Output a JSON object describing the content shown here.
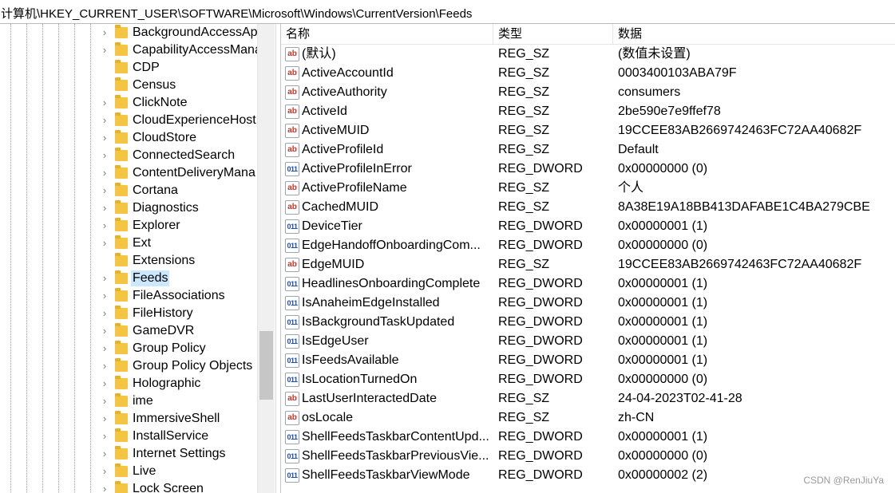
{
  "address": "计算机\\HKEY_CURRENT_USER\\SOFTWARE\\Microsoft\\Windows\\CurrentVersion\\Feeds",
  "tree": {
    "items": [
      {
        "label": "BackgroundAccessAp",
        "expandable": true,
        "selected": false
      },
      {
        "label": "CapabilityAccessMana",
        "expandable": true,
        "selected": false
      },
      {
        "label": "CDP",
        "expandable": false,
        "selected": false
      },
      {
        "label": "Census",
        "expandable": false,
        "selected": false
      },
      {
        "label": "ClickNote",
        "expandable": true,
        "selected": false
      },
      {
        "label": "CloudExperienceHost",
        "expandable": true,
        "selected": false
      },
      {
        "label": "CloudStore",
        "expandable": true,
        "selected": false
      },
      {
        "label": "ConnectedSearch",
        "expandable": true,
        "selected": false
      },
      {
        "label": "ContentDeliveryMana",
        "expandable": true,
        "selected": false
      },
      {
        "label": "Cortana",
        "expandable": true,
        "selected": false
      },
      {
        "label": "Diagnostics",
        "expandable": true,
        "selected": false
      },
      {
        "label": "Explorer",
        "expandable": true,
        "selected": false
      },
      {
        "label": "Ext",
        "expandable": true,
        "selected": false
      },
      {
        "label": "Extensions",
        "expandable": false,
        "selected": false
      },
      {
        "label": "Feeds",
        "expandable": true,
        "selected": true
      },
      {
        "label": "FileAssociations",
        "expandable": true,
        "selected": false
      },
      {
        "label": "FileHistory",
        "expandable": true,
        "selected": false
      },
      {
        "label": "GameDVR",
        "expandable": true,
        "selected": false
      },
      {
        "label": "Group Policy",
        "expandable": true,
        "selected": false
      },
      {
        "label": "Group Policy Objects",
        "expandable": true,
        "selected": false
      },
      {
        "label": "Holographic",
        "expandable": true,
        "selected": false
      },
      {
        "label": "ime",
        "expandable": true,
        "selected": false
      },
      {
        "label": "ImmersiveShell",
        "expandable": true,
        "selected": false
      },
      {
        "label": "InstallService",
        "expandable": true,
        "selected": false
      },
      {
        "label": "Internet Settings",
        "expandable": true,
        "selected": false
      },
      {
        "label": "Live",
        "expandable": true,
        "selected": false
      },
      {
        "label": "Lock Screen",
        "expandable": true,
        "selected": false
      }
    ]
  },
  "columns": {
    "name": "名称",
    "type": "类型",
    "data": "数据"
  },
  "values": [
    {
      "icon": "string-value-icon",
      "name": "(默认)",
      "type": "REG_SZ",
      "data": "(数值未设置)"
    },
    {
      "icon": "string-value-icon",
      "name": "ActiveAccountId",
      "type": "REG_SZ",
      "data": "0003400103ABA79F"
    },
    {
      "icon": "string-value-icon",
      "name": "ActiveAuthority",
      "type": "REG_SZ",
      "data": "consumers"
    },
    {
      "icon": "string-value-icon",
      "name": "ActiveId",
      "type": "REG_SZ",
      "data": "2be590e7e9ffef78"
    },
    {
      "icon": "string-value-icon",
      "name": "ActiveMUID",
      "type": "REG_SZ",
      "data": "19CCEE83AB2669742463FC72AA40682F"
    },
    {
      "icon": "string-value-icon",
      "name": "ActiveProfileId",
      "type": "REG_SZ",
      "data": "Default"
    },
    {
      "icon": "binary-value-icon",
      "name": "ActiveProfileInError",
      "type": "REG_DWORD",
      "data": "0x00000000 (0)"
    },
    {
      "icon": "string-value-icon",
      "name": "ActiveProfileName",
      "type": "REG_SZ",
      "data": "个人"
    },
    {
      "icon": "string-value-icon",
      "name": "CachedMUID",
      "type": "REG_SZ",
      "data": "8A38E19A18BB413DAFABE1C4BA279CBE"
    },
    {
      "icon": "binary-value-icon",
      "name": "DeviceTier",
      "type": "REG_DWORD",
      "data": "0x00000001 (1)"
    },
    {
      "icon": "binary-value-icon",
      "name": "EdgeHandoffOnboardingCom...",
      "type": "REG_DWORD",
      "data": "0x00000000 (0)"
    },
    {
      "icon": "string-value-icon",
      "name": "EdgeMUID",
      "type": "REG_SZ",
      "data": "19CCEE83AB2669742463FC72AA40682F"
    },
    {
      "icon": "binary-value-icon",
      "name": "HeadlinesOnboardingComplete",
      "type": "REG_DWORD",
      "data": "0x00000001 (1)"
    },
    {
      "icon": "binary-value-icon",
      "name": "IsAnaheimEdgeInstalled",
      "type": "REG_DWORD",
      "data": "0x00000001 (1)"
    },
    {
      "icon": "binary-value-icon",
      "name": "IsBackgroundTaskUpdated",
      "type": "REG_DWORD",
      "data": "0x00000001 (1)"
    },
    {
      "icon": "binary-value-icon",
      "name": "IsEdgeUser",
      "type": "REG_DWORD",
      "data": "0x00000001 (1)"
    },
    {
      "icon": "binary-value-icon",
      "name": "IsFeedsAvailable",
      "type": "REG_DWORD",
      "data": "0x00000001 (1)"
    },
    {
      "icon": "binary-value-icon",
      "name": "IsLocationTurnedOn",
      "type": "REG_DWORD",
      "data": "0x00000000 (0)"
    },
    {
      "icon": "string-value-icon",
      "name": "LastUserInteractedDate",
      "type": "REG_SZ",
      "data": "24-04-2023T02-41-28"
    },
    {
      "icon": "string-value-icon",
      "name": "osLocale",
      "type": "REG_SZ",
      "data": "zh-CN"
    },
    {
      "icon": "binary-value-icon",
      "name": "ShellFeedsTaskbarContentUpd...",
      "type": "REG_DWORD",
      "data": "0x00000001 (1)"
    },
    {
      "icon": "binary-value-icon",
      "name": "ShellFeedsTaskbarPreviousVie...",
      "type": "REG_DWORD",
      "data": "0x00000000 (0)"
    },
    {
      "icon": "binary-value-icon",
      "name": "ShellFeedsTaskbarViewMode",
      "type": "REG_DWORD",
      "data": "0x00000002 (2)"
    }
  ],
  "icons": {
    "string_glyph": "ab",
    "binary_glyph": "011"
  },
  "watermark": "CSDN @RenJiuYa"
}
